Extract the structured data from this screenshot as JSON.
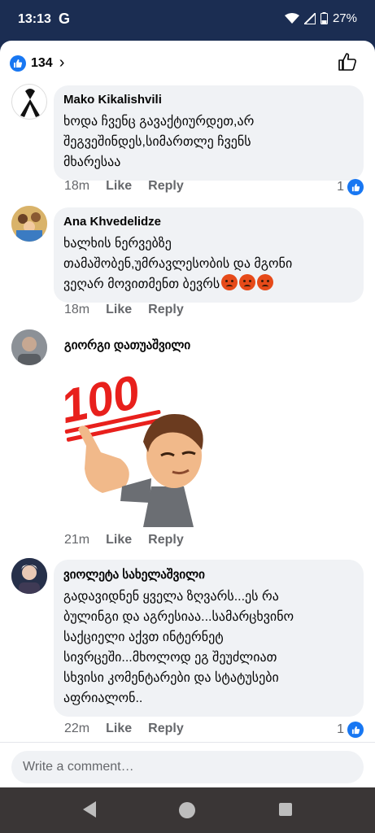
{
  "status_bar": {
    "time": "13:13",
    "google_icon": "G",
    "battery": "27%"
  },
  "header": {
    "reaction_count": "134",
    "like_icon": "thumbs-up-outline-icon"
  },
  "comments": [
    {
      "author": "Mako Kikalishvili",
      "lines": [
        "ხოდა ჩვენც გავაქტიურდეთ,არ",
        "შეგვეშინდეს,სიმართლე ჩვენს",
        "მხარესაა"
      ],
      "time": "18m",
      "like": "Like",
      "reply": "Reply",
      "likes": "1"
    },
    {
      "author": "Ana Khvedelidze",
      "lines": [
        "ხალხის ნერვებზე",
        "თამაშობენ,უმრავლესობის და მგონი",
        "ვეღარ მოვითმენთ ბევრს"
      ],
      "time": "18m",
      "like": "Like",
      "reply": "Reply"
    },
    {
      "author": "გიორგი დათუაშვილი",
      "sticker": "100-emoji-sticker",
      "time": "21m",
      "like": "Like",
      "reply": "Reply"
    },
    {
      "author": "ვიოლეტა სახელაშვილი",
      "lines": [
        "გადავიდნენ ყველა ზღვარს...ეს რა",
        "ბულინგი და აგრესიაა...სამარცხვინო",
        "საქციელი აქვთ ინტერნეტ",
        "სივრცეში...მხოლოდ ეგ შეუძლიათ",
        "სხვისი კომენტარები და სტატუსები",
        "აფრიალონ.."
      ],
      "time": "22m",
      "like": "Like",
      "reply": "Reply",
      "likes": "1"
    }
  ],
  "composer": {
    "placeholder": "Write a comment…"
  },
  "colors": {
    "facebook_blue": "#1877f2",
    "bubble": "#f0f2f5",
    "status_bar": "#1b2d52",
    "nav_bar": "#3a3636"
  }
}
